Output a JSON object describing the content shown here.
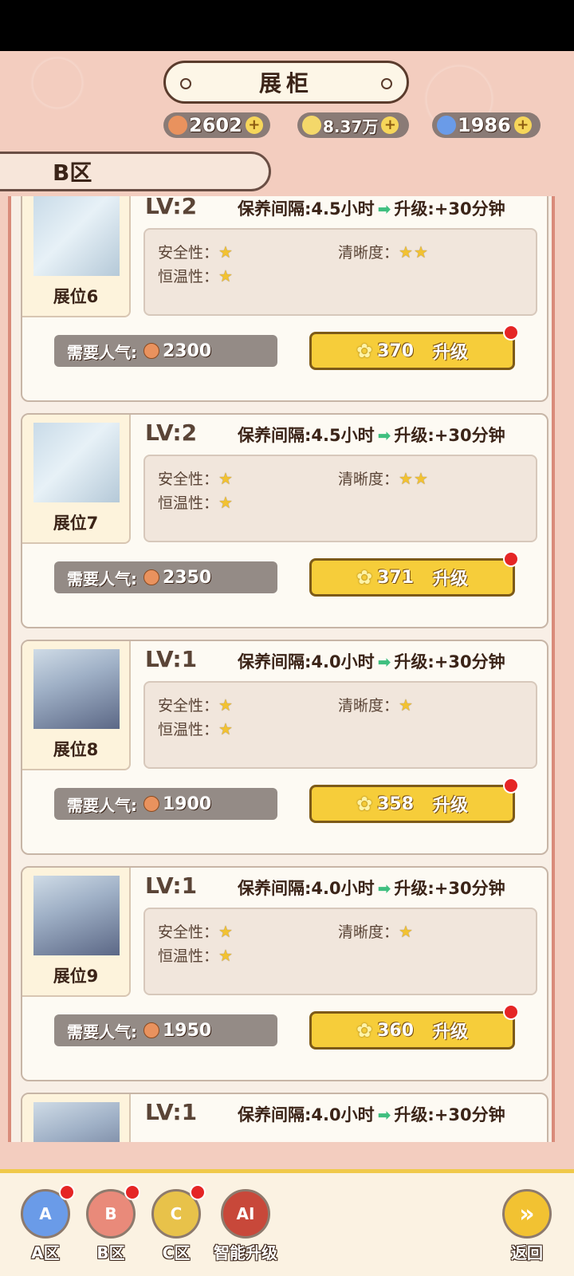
{
  "title": "展柜",
  "resources": [
    {
      "icon": "popularity-pin-icon",
      "value": "2602",
      "color": "#e9925e"
    },
    {
      "icon": "flower-coin-icon",
      "value": "8.37万",
      "color": "#f4d86a"
    },
    {
      "icon": "blue-gem-icon",
      "value": "1986",
      "color": "#6a9be8"
    }
  ],
  "zone": "B区",
  "labels": {
    "safety": "安全性：",
    "clarity": "清晰度：",
    "temp": "恒温性：",
    "need": "需要人气:",
    "upgrade": "升级",
    "arrow": "➡"
  },
  "cards": [
    {
      "name": "展位6",
      "lv": "LV:2",
      "interval": "保养间隔:4.5小时",
      "bonus": "升级:+30分钟",
      "safety": "★",
      "clarity": "★★",
      "temp": "★",
      "need": "2300",
      "cost": "370"
    },
    {
      "name": "展位7",
      "lv": "LV:2",
      "interval": "保养间隔:4.5小时",
      "bonus": "升级:+30分钟",
      "safety": "★",
      "clarity": "★★",
      "temp": "★",
      "need": "2350",
      "cost": "371"
    },
    {
      "name": "展位8",
      "lv": "LV:1",
      "interval": "保养间隔:4.0小时",
      "bonus": "升级:+30分钟",
      "safety": "★",
      "clarity": "★",
      "temp": "★",
      "need": "1900",
      "cost": "358"
    },
    {
      "name": "展位9",
      "lv": "LV:1",
      "interval": "保养间隔:4.0小时",
      "bonus": "升级:+30分钟",
      "safety": "★",
      "clarity": "★",
      "temp": "★",
      "need": "1950",
      "cost": "360"
    },
    {
      "name": "",
      "lv": "LV:1",
      "interval": "保养间隔:4.0小时",
      "bonus": "升级:+30分钟",
      "safety": "",
      "clarity": "",
      "temp": "",
      "need": "",
      "cost": ""
    }
  ],
  "nav": [
    {
      "label": "A区",
      "badge": "A",
      "color": "#6a9be8",
      "dot": true
    },
    {
      "label": "B区",
      "badge": "B",
      "color": "#e98a7a",
      "dot": true
    },
    {
      "label": "C区",
      "badge": "C",
      "color": "#e8c24a",
      "dot": true
    },
    {
      "label": "智能升级",
      "badge": "AI",
      "color": "#c8483a",
      "dot": false
    },
    {
      "label": "返回",
      "badge": "»",
      "color": "#f2c232",
      "dot": false
    }
  ]
}
